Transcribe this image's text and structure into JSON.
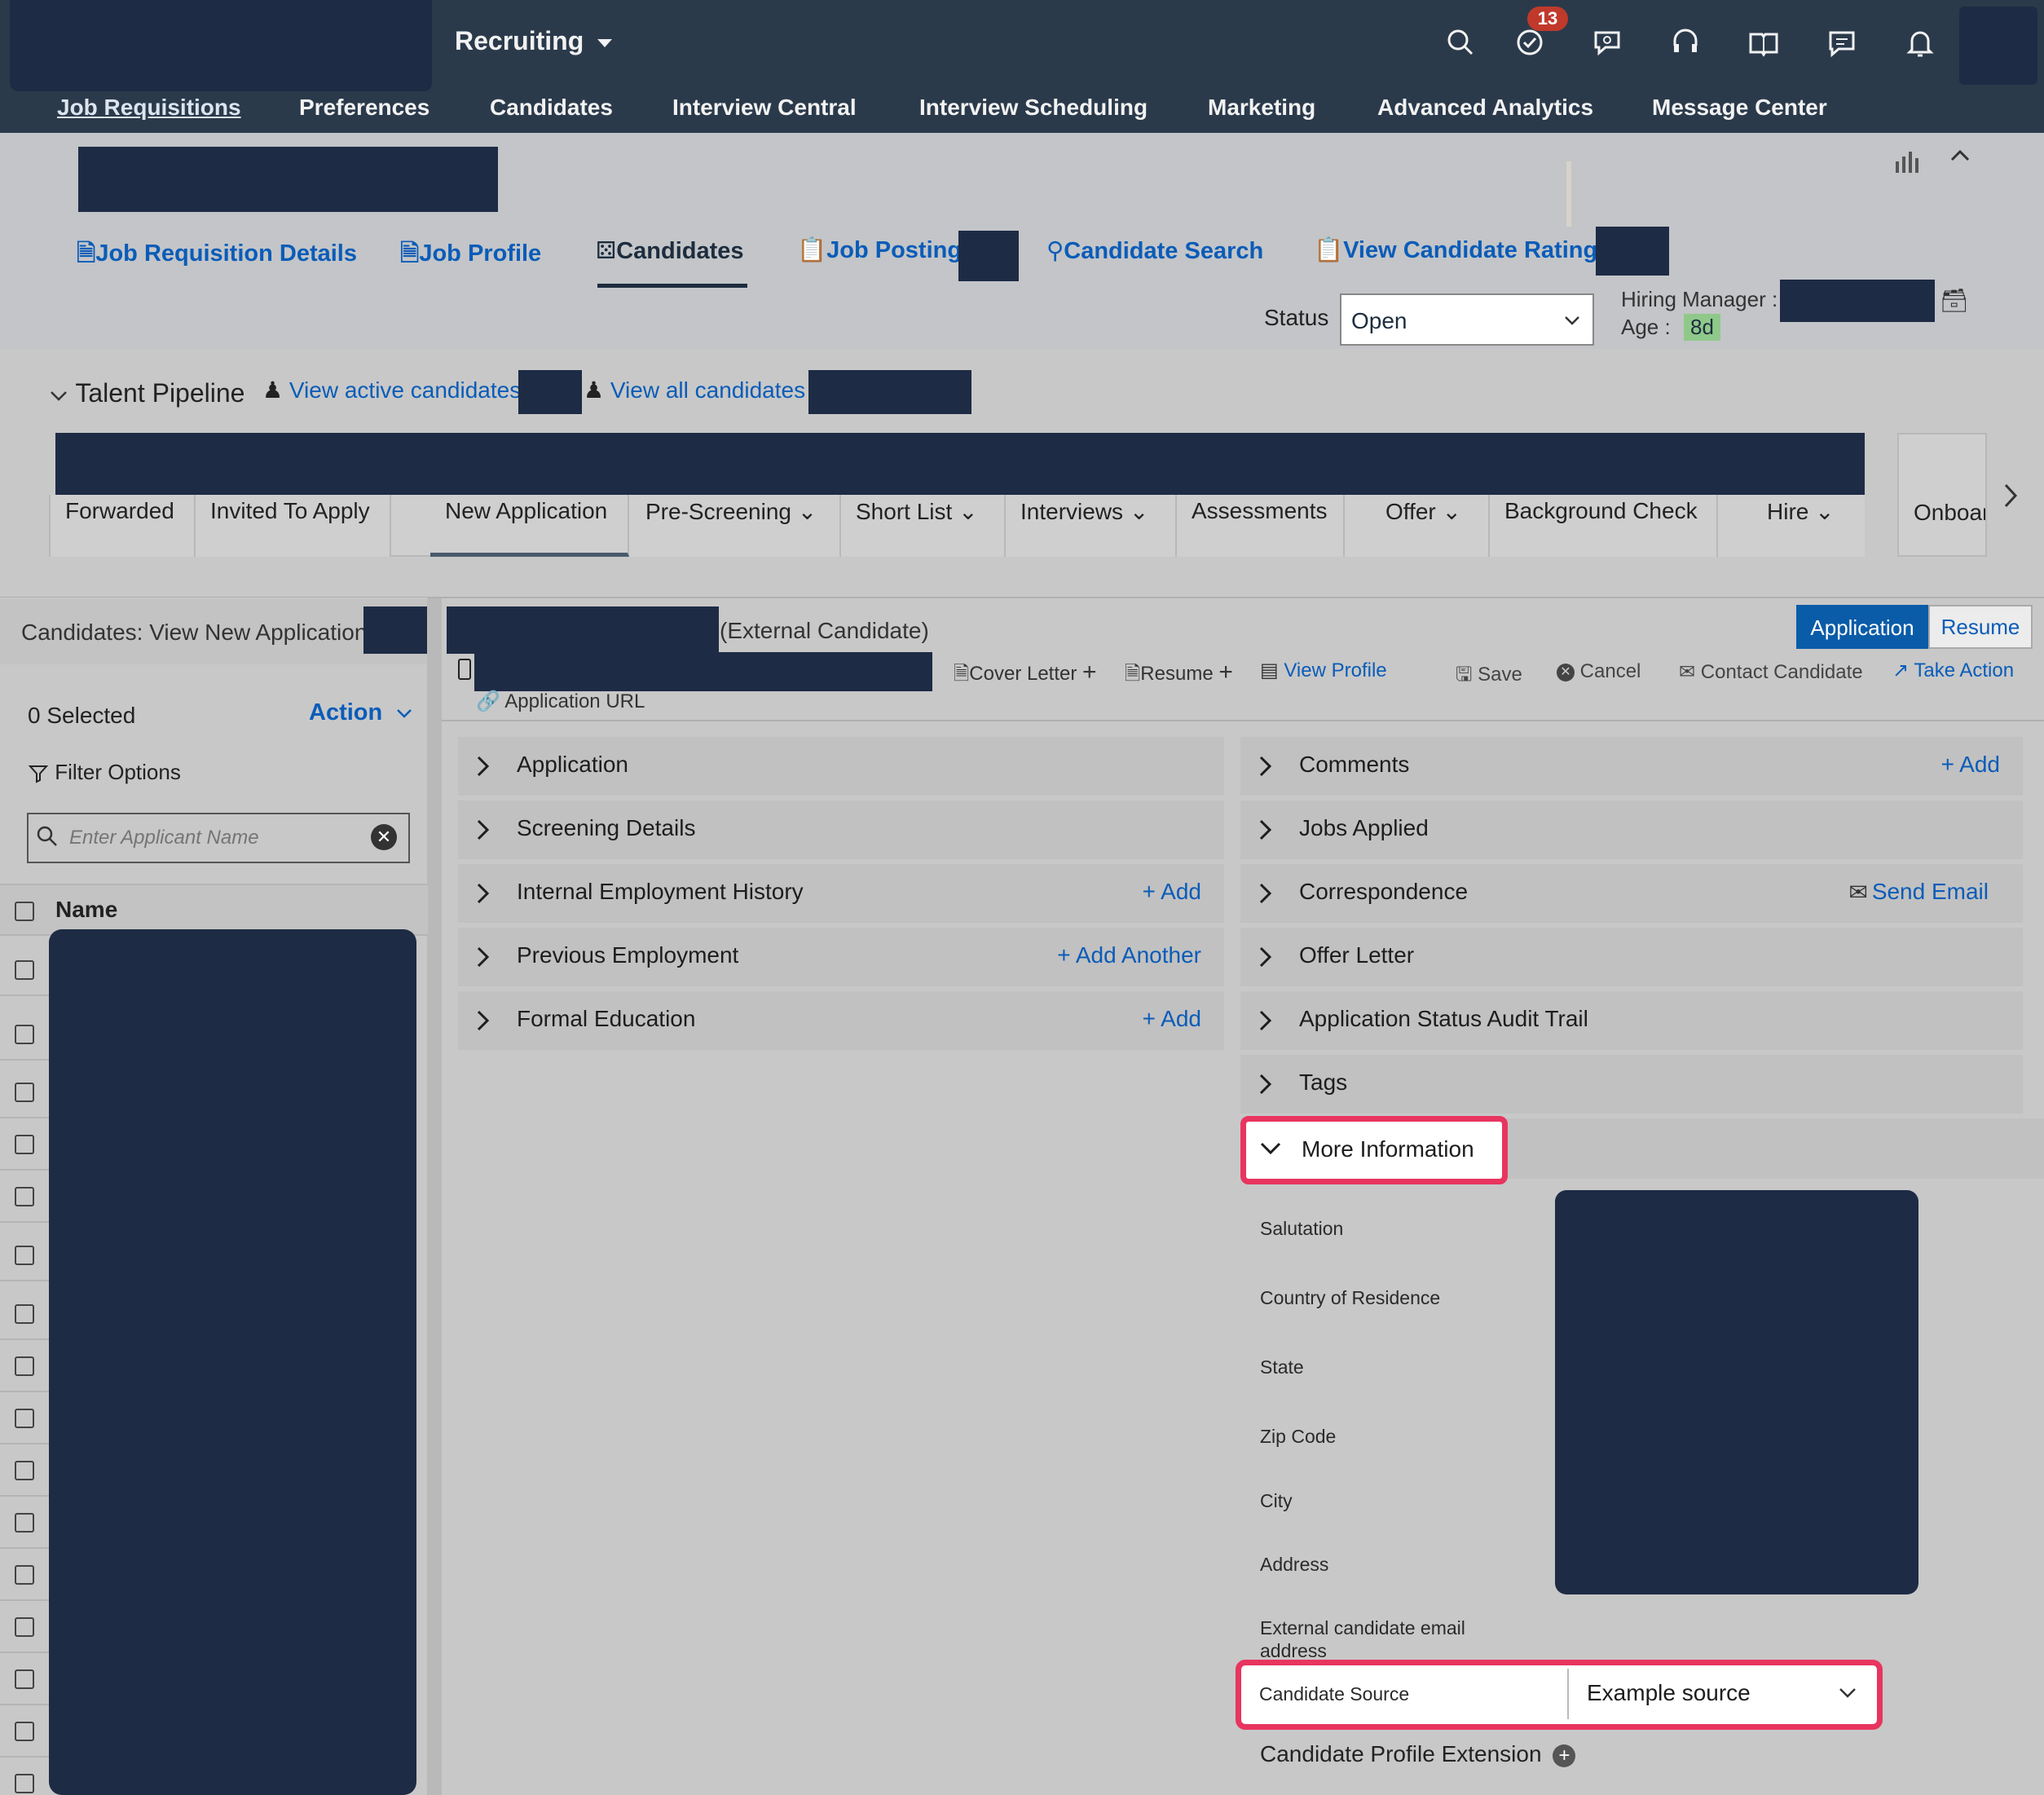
{
  "shell": {
    "app_menu": "Recruiting",
    "notification_count": "13",
    "icons": [
      "search-icon",
      "todo-icon",
      "chat-icon",
      "support-icon",
      "guide-icon",
      "feedback-icon",
      "bell-icon"
    ]
  },
  "nav": [
    "Job Requisitions",
    "Preferences",
    "Candidates",
    "Interview Central",
    "Interview Scheduling",
    "Marketing",
    "Advanced Analytics",
    "Message Center"
  ],
  "req_tabs": {
    "details": "Job Requisition Details",
    "profile": "Job Profile",
    "candidates": "Candidates",
    "postings": "Job Postings",
    "search": "Candidate Search",
    "ratings": "View Candidate Ratings"
  },
  "status": {
    "label": "Status",
    "value": "Open"
  },
  "hiring_manager": {
    "label": "Hiring Manager :",
    "age_label": "Age :",
    "age_value": "8d"
  },
  "pipeline": {
    "title": "Talent Pipeline",
    "view_active": "View active candidates",
    "view_all": "View all candidates",
    "stages": [
      "Forwarded",
      "Invited To Apply",
      "New Application",
      "Pre-Screening",
      "Short List",
      "Interviews",
      "Assessments",
      "Offer",
      "Background Check",
      "Hire",
      "Onboar"
    ]
  },
  "left": {
    "title": "Candidates: View New Application",
    "selected": "0 Selected",
    "action": "Action",
    "filter": "Filter Options",
    "search_placeholder": "Enter Applicant Name",
    "name_header": "Name"
  },
  "candidate": {
    "type": "(External Candidate)",
    "cover_letter": "Cover Letter",
    "resume": "Resume",
    "view_profile": "View Profile",
    "application_url": "Application URL",
    "save": "Save",
    "cancel": "Cancel",
    "contact": "Contact Candidate",
    "take_action": "Take Action",
    "toggle_application": "Application",
    "toggle_resume": "Resume"
  },
  "sections_left": [
    {
      "label": "Application",
      "action": ""
    },
    {
      "label": "Screening Details",
      "action": ""
    },
    {
      "label": "Internal Employment History",
      "action": "+ Add"
    },
    {
      "label": "Previous Employment",
      "action": "+ Add Another"
    },
    {
      "label": "Formal Education",
      "action": "+ Add"
    }
  ],
  "sections_right": [
    {
      "label": "Comments",
      "action": "+ Add"
    },
    {
      "label": "Jobs Applied",
      "action": ""
    },
    {
      "label": "Correspondence",
      "action": "Send Email"
    },
    {
      "label": "Offer Letter",
      "action": ""
    },
    {
      "label": "Application Status Audit Trail",
      "action": ""
    },
    {
      "label": "Tags",
      "action": ""
    }
  ],
  "more_info": {
    "title": "More Information",
    "fields": [
      "Salutation",
      "Country of Residence",
      "State",
      "Zip Code",
      "City",
      "Address",
      "External candidate email address"
    ],
    "source_label": "Candidate Source",
    "source_value": "Example source",
    "extension": "Candidate Profile Extension"
  },
  "colors": {
    "shell_bg": "#2b3a4b",
    "redaction": "#1d2b45",
    "link": "#0a5cb8",
    "highlight": "#e8355f",
    "badge": "#c0392b",
    "age_badge": "#8fc98a"
  }
}
